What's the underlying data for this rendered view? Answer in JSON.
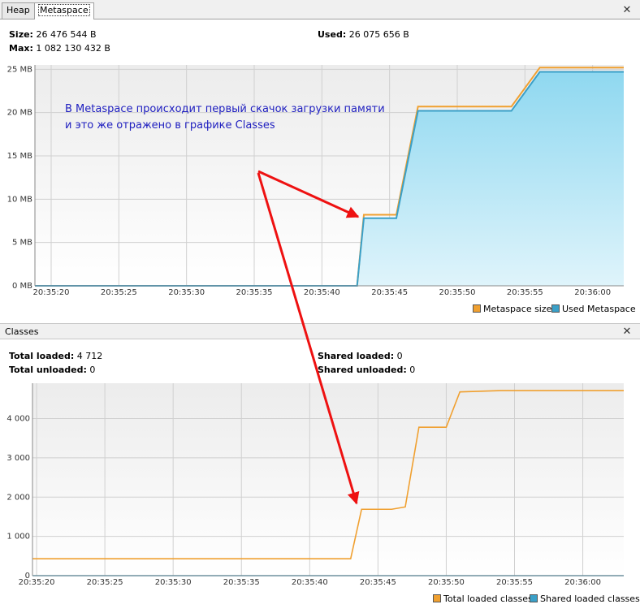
{
  "tabs": [
    {
      "label": "Heap",
      "active": false
    },
    {
      "label": "Metaspace",
      "active": true
    }
  ],
  "close_symbol": "✕",
  "metaspace": {
    "size_label": "Size:",
    "size_value": "26 476 544 B",
    "max_label": "Max:",
    "max_value": "1 082 130 432 B",
    "used_label": "Used:",
    "used_value": "26 075 656 B",
    "legend": {
      "size": "Metaspace size",
      "used": "Used Metaspace"
    }
  },
  "annotation": {
    "line1": "В Metaspace происходит первый скачок загрузки памяти",
    "line2": "и это же отражено в графике Classes"
  },
  "classes": {
    "title": "Classes",
    "total_loaded_label": "Total loaded:",
    "total_loaded_value": "4 712",
    "total_unloaded_label": "Total unloaded:",
    "total_unloaded_value": "0",
    "shared_loaded_label": "Shared loaded:",
    "shared_loaded_value": "0",
    "shared_unloaded_label": "Shared unloaded:",
    "shared_unloaded_value": "0",
    "legend": {
      "total": "Total loaded classes",
      "shared": "Shared loaded classes"
    }
  },
  "colors": {
    "orange": "#f0a030",
    "blue": "#3aa0c8",
    "fill": "#a8e0f4",
    "arrow": "#ee1111",
    "annotation": "#2020c0"
  },
  "chart_data": [
    {
      "type": "area",
      "x_ticks": [
        "20:35:20",
        "20:35:25",
        "20:35:30",
        "20:35:35",
        "20:35:40",
        "20:35:45",
        "20:35:50",
        "20:35:55",
        "20:36:00"
      ],
      "y_ticks": [
        "0 MB",
        "5 MB",
        "10 MB",
        "15 MB",
        "20 MB",
        "25 MB"
      ],
      "ylim": [
        0,
        25.5
      ],
      "xlim": [
        -1.2,
        42.3
      ],
      "series": [
        {
          "name": "Metaspace size",
          "color": "#f0a030",
          "x": [
            -1.2,
            22.5,
            22.6,
            23.1,
            25.4,
            25.5,
            27.1,
            30.5,
            30.6,
            33.8,
            34.0,
            36.1,
            42.3
          ],
          "y": [
            0,
            0,
            0,
            8.2,
            8.2,
            8.2,
            20.7,
            20.7,
            20.7,
            20.7,
            20.7,
            25.2,
            25.2
          ]
        },
        {
          "name": "Used Metaspace",
          "color": "#3aa0c8",
          "x": [
            -1.2,
            22.5,
            22.6,
            23.1,
            25.4,
            25.5,
            27.1,
            30.5,
            30.6,
            33.8,
            34.0,
            36.1,
            42.3
          ],
          "y": [
            0,
            0,
            0,
            7.8,
            7.8,
            7.8,
            20.2,
            20.2,
            20.2,
            20.2,
            20.2,
            24.7,
            24.7
          ]
        }
      ]
    },
    {
      "type": "line",
      "x_ticks": [
        "20:35:20",
        "20:35:25",
        "20:35:30",
        "20:35:35",
        "20:35:40",
        "20:35:45",
        "20:35:50",
        "20:35:55",
        "20:36:00"
      ],
      "y_ticks": [
        "0",
        "1 000",
        "2 000",
        "3 000",
        "4 000"
      ],
      "ylim": [
        0,
        4900
      ],
      "xlim": [
        -0.3,
        43.0
      ],
      "series": [
        {
          "name": "Total loaded classes",
          "color": "#f0a030",
          "x": [
            -0.3,
            23.0,
            23.8,
            26.0,
            27.0,
            28.0,
            30.0,
            31.0,
            34.0,
            43.0
          ],
          "y": [
            430,
            430,
            1690,
            1690,
            1750,
            3780,
            3780,
            4680,
            4712,
            4712
          ]
        },
        {
          "name": "Shared loaded classes",
          "color": "#3aa0c8",
          "x": [
            -0.3,
            43.0
          ],
          "y": [
            0,
            0
          ]
        }
      ]
    }
  ]
}
